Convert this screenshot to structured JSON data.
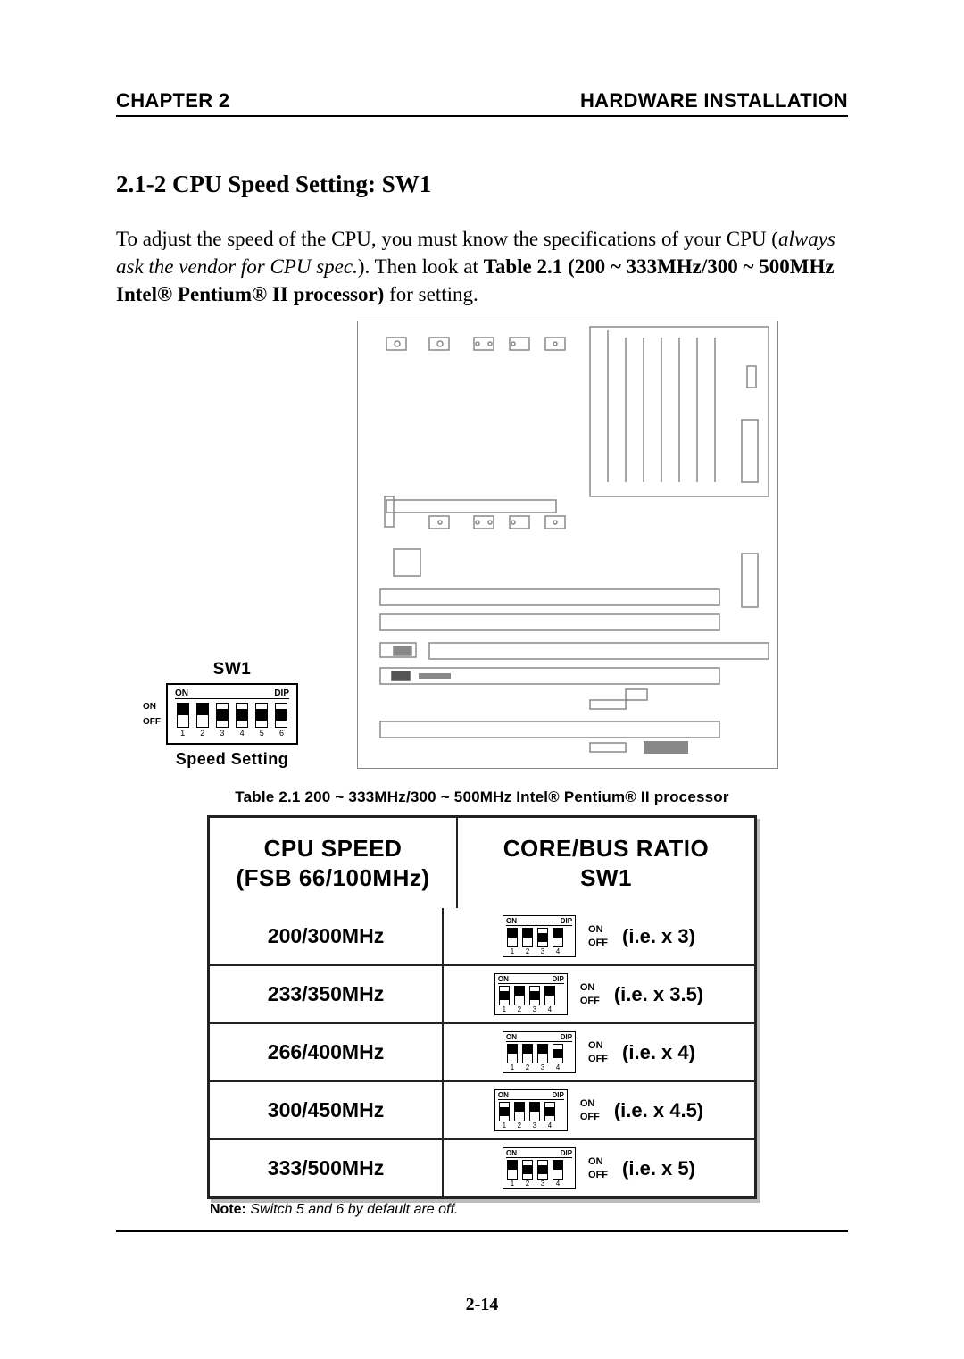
{
  "header": {
    "left": "CHAPTER 2",
    "right": "HARDWARE INSTALLATION"
  },
  "section": {
    "title": "2.1-2 CPU Speed Setting:  SW1",
    "para_pre": "To adjust the speed of  the CPU, you must know the specifications of your CPU (",
    "para_italic": "always ask the vendor for CPU spec.",
    "para_mid": ").  Then look at  ",
    "para_bold": "Table 2.1 (200 ~ 333MHz/300 ~ 500MHz Intel® Pentium® II processor)",
    "para_post": " for setting."
  },
  "sw1_panel": {
    "title": "SW1",
    "box_on": "ON",
    "box_dip": "DIP",
    "side_on": "ON",
    "side_off": "OFF",
    "subtitle": "Speed Setting",
    "switches": [
      "on",
      "on",
      "off",
      "off",
      "off",
      "off"
    ],
    "numbers": [
      "1",
      "2",
      "3",
      "4",
      "5",
      "6"
    ]
  },
  "table_caption": "Table 2.1 200 ~ 333MHz/300 ~ 500MHz  Intel® Pentium® II processor",
  "table": {
    "head_left_l1": "CPU SPEED",
    "head_left_l2": "(FSB 66/100MHz)",
    "head_right_l1": "CORE/BUS RATIO",
    "head_right_l2": "SW1",
    "minidip_on": "ON",
    "minidip_dip": "DIP",
    "side_on": "ON",
    "side_off": "OFF",
    "rows": [
      {
        "speed": "200/300MHz",
        "switches": [
          "on",
          "on",
          "off",
          "on"
        ],
        "ratio": "(i.e. x 3)"
      },
      {
        "speed": "233/350MHz",
        "switches": [
          "off",
          "on",
          "off",
          "on"
        ],
        "ratio": "(i.e. x 3.5)"
      },
      {
        "speed": "266/400MHz",
        "switches": [
          "on",
          "on",
          "on",
          "off"
        ],
        "ratio": "(i.e. x 4)"
      },
      {
        "speed": "300/450MHz",
        "switches": [
          "off",
          "on",
          "on",
          "off"
        ],
        "ratio": "(i.e. x 4.5)"
      },
      {
        "speed": "333/500MHz",
        "switches": [
          "on",
          "off",
          "off",
          "on"
        ],
        "ratio": "(i.e. x 5)"
      }
    ],
    "numbers": [
      "1",
      "2",
      "3",
      "4"
    ]
  },
  "note": {
    "label": "Note:",
    "text": "  Switch 5 and 6 by default are off."
  },
  "page_number": "2-14"
}
